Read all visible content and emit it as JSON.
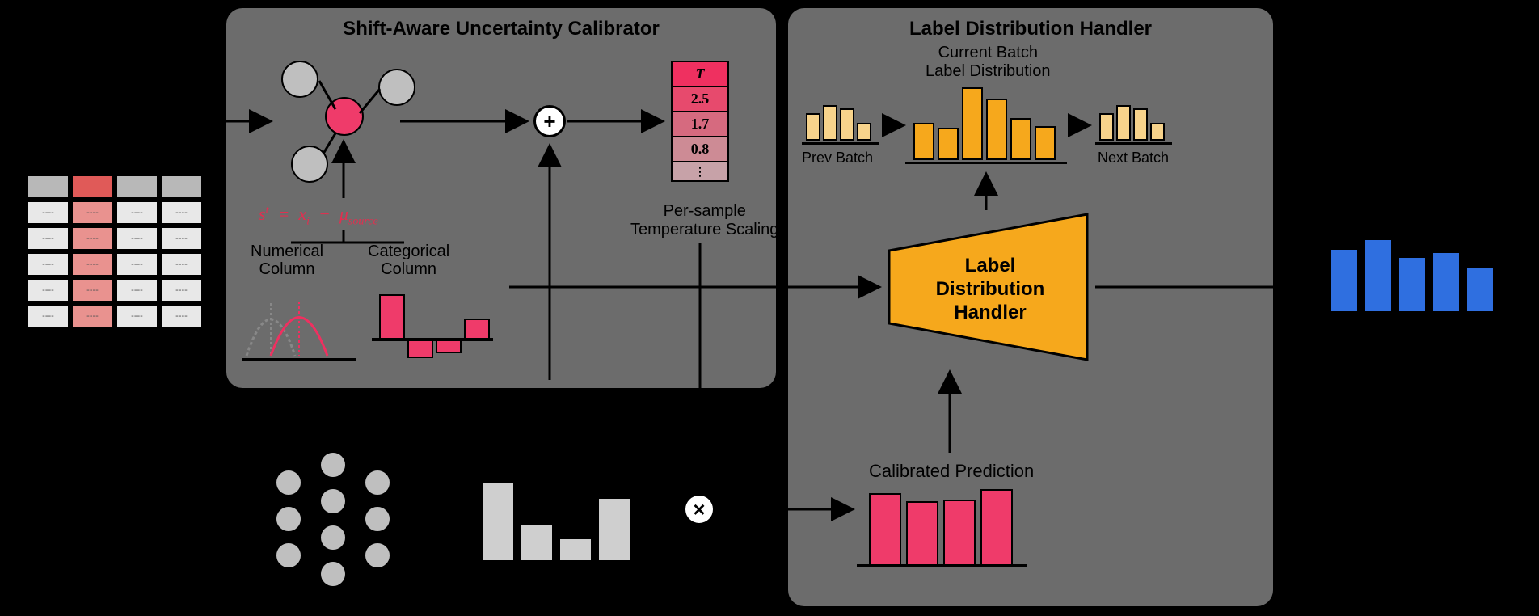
{
  "panels": {
    "calibrator": {
      "title": "Shift-Aware Uncertainty Calibrator"
    },
    "handler": {
      "title": "Label Distribution Handler"
    }
  },
  "formula": "sᵗ = xᵢ − μ_source",
  "columns": {
    "numerical": "Numerical\nColumn",
    "categorical": "Categorical\nColumn"
  },
  "temperature": {
    "header": "T",
    "rows": [
      "2.5",
      "1.7",
      "0.8",
      "⋮"
    ],
    "caption": "Per-sample\nTemperature Scaling"
  },
  "batch": {
    "prev": "Prev Batch",
    "current": "Current Batch\nLabel Distribution",
    "next": "Next Batch"
  },
  "handler_block": "Label\nDistribution\nHandler",
  "calibrated": "Calibrated Prediction",
  "chart_data": {
    "type": "diagram",
    "bars": {
      "categorical_delta": [
        60,
        -20,
        -15,
        25
      ],
      "network_output_gray": [
        65,
        32,
        20,
        52
      ],
      "calibrated_pink": [
        78,
        70,
        72,
        82
      ],
      "prev_batch": [
        34,
        44,
        40,
        22
      ],
      "current_batch": [
        46,
        40,
        90,
        76,
        52,
        42
      ],
      "next_batch": [
        34,
        44,
        40,
        22
      ],
      "output_blue": [
        80,
        92,
        70,
        76,
        58
      ]
    }
  }
}
